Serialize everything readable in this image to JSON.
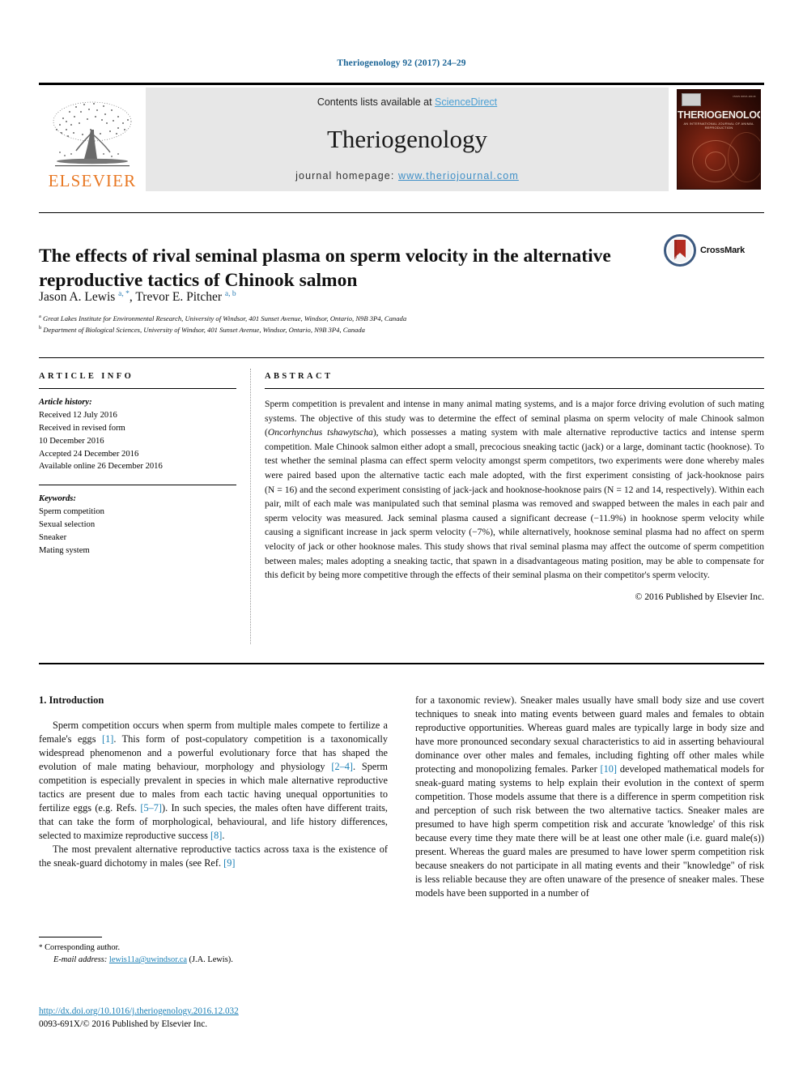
{
  "running_head": "Theriogenology 92 (2017) 24–29",
  "masthead": {
    "publisher_logo_text": "ELSEVIER",
    "contents_prefix": "Contents lists available at ",
    "contents_link": "ScienceDirect",
    "journal_name": "Theriogenology",
    "homepage_prefix": "journal homepage: ",
    "homepage_url": "www.theriojournal.com",
    "cover": {
      "title": "THERIOGENOLOGY",
      "subtitle": "AN INTERNATIONAL JOURNAL OF ANIMAL REPRODUCTION",
      "issn": "ISSN 0093-691X"
    }
  },
  "article": {
    "title": "The effects of rival seminal plasma on sperm velocity in the alternative reproductive tactics of Chinook salmon",
    "crossmark_label": "CrossMark",
    "authors_html": "Jason A. Lewis <sup>a, *</sup>, Trevor E. Pitcher <sup>a, b</sup>",
    "affiliations": [
      {
        "marker": "a",
        "text": "Great Lakes Institute for Environmental Research, University of Windsor, 401 Sunset Avenue, Windsor, Ontario, N9B 3P4, Canada"
      },
      {
        "marker": "b",
        "text": "Department of Biological Sciences, University of Windsor, 401 Sunset Avenue, Windsor, Ontario, N9B 3P4, Canada"
      }
    ]
  },
  "article_info": {
    "heading": "ARTICLE INFO",
    "history_label": "Article history:",
    "history": [
      "Received 12 July 2016",
      "Received in revised form",
      "10 December 2016",
      "Accepted 24 December 2016",
      "Available online 26 December 2016"
    ],
    "keywords_label": "Keywords:",
    "keywords": [
      "Sperm competition",
      "Sexual selection",
      "Sneaker",
      "Mating system"
    ]
  },
  "abstract": {
    "heading": "ABSTRACT",
    "paragraph_html": "Sperm competition is prevalent and intense in many animal mating systems, and is a major force driving evolution of such mating systems. The objective of this study was to determine the effect of seminal plasma on sperm velocity of male Chinook salmon (<i>Oncorhynchus tshawytscha</i>), which possesses a mating system with male alternative reproductive tactics and intense sperm competition. Male Chinook salmon either adopt a small, precocious sneaking tactic (jack) or a large, dominant tactic (hooknose). To test whether the seminal plasma can effect sperm velocity amongst sperm competitors, two experiments were done whereby males were paired based upon the alternative tactic each male adopted, with the first experiment consisting of jack-hooknose pairs (N&nbsp;=&nbsp;16) and the second experiment consisting of jack-jack and hooknose-hooknose pairs (N&nbsp;=&nbsp;12 and 14, respectively). Within each pair, milt of each male was manipulated such that seminal plasma was removed and swapped between the males in each pair and sperm velocity was measured. Jack seminal plasma caused a significant decrease (&minus;11.9%) in hooknose sperm velocity while causing a significant increase in jack sperm velocity (&minus;7%), while alternatively, hooknose seminal plasma had no affect on sperm velocity of jack or other hooknose males. This study shows that rival seminal plasma may affect the outcome of sperm competition between males; males adopting a sneaking tactic, that spawn in a disadvantageous mating position, may be able to compensate for this deficit by being more competitive through the effects of their seminal plasma on their competitor's sperm velocity.",
    "copyright": "© 2016 Published by Elsevier Inc."
  },
  "body": {
    "section_heading": "1. Introduction",
    "left_paragraphs_html": [
      "Sperm competition occurs when sperm from multiple males compete to fertilize a female's eggs <span class=\"ref\">[1]</span>. This form of post-copulatory competition is a taxonomically widespread phenomenon and a powerful evolutionary force that has shaped the evolution of male mating behaviour, morphology and physiology <span class=\"ref\">[2&ndash;4]</span>. Sperm competition is especially prevalent in species in which male alternative reproductive tactics are present due to males from each tactic having unequal opportunities to fertilize eggs (e.g. Refs. <span class=\"ref\">[5&ndash;7]</span>). In such species, the males often have different traits, that can take the form of morphological, behavioural, and life history differences, selected to maximize reproductive success <span class=\"ref\">[8]</span>.",
      "The most prevalent alternative reproductive tactics across taxa is the existence of the sneak-guard dichotomy in males (see Ref. <span class=\"ref\">[9]</span>"
    ],
    "right_paragraphs_html": [
      "for a taxonomic review). Sneaker males usually have small body size and use covert techniques to sneak into mating events between guard males and females to obtain reproductive opportunities. Whereas guard males are typically large in body size and have more pronounced secondary sexual characteristics to aid in asserting behavioural dominance over other males and females, including fighting off other males while protecting and monopolizing females. Parker <span class=\"ref\">[10]</span> developed mathematical models for sneak-guard mating systems to help explain their evolution in the context of sperm competition. Those models assume that there is a difference in sperm competition risk and perception of such risk between the two alternative tactics. Sneaker males are presumed to have high sperm competition risk and accurate 'knowledge' of this risk because every time they mate there will be at least one other male (i.e. guard male(s)) present. Whereas the guard males are presumed to have lower sperm competition risk because sneakers do not participate in all mating events and their \"knowledge\" of risk is less reliable because they are often unaware of the presence of sneaker males. These models have been supported in a number of"
    ]
  },
  "footer": {
    "corresponding_label": "Corresponding author.",
    "email_label": "E-mail address:",
    "email": "lewis11a@uwindsor.ca",
    "email_owner": "(J.A. Lewis).",
    "doi": "http://dx.doi.org/10.1016/j.theriogenology.2016.12.032",
    "issn_line": "0093-691X/© 2016 Published by Elsevier Inc."
  },
  "colors": {
    "link_blue": "#1a7fb5",
    "elsevier_orange": "#e87722",
    "masthead_gray": "#e7e7e7"
  }
}
